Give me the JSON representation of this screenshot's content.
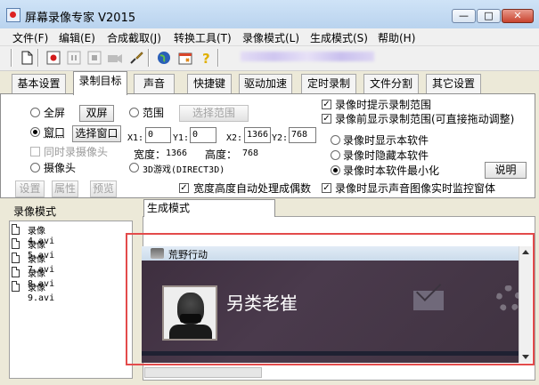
{
  "window": {
    "title": "屏幕录像专家 V2015",
    "min": "—",
    "max": "□",
    "close": "✕"
  },
  "menu": [
    "文件(F)",
    "编辑(E)",
    "合成截取(J)",
    "转换工具(T)",
    "录像模式(L)",
    "生成模式(S)",
    "帮助(H)"
  ],
  "toolbar_icons": [
    "new-file-icon",
    "record-icon",
    "pause-icon",
    "stop-icon",
    "camera-icon",
    "brush-icon",
    "globe-icon",
    "calendar-icon",
    "help-icon"
  ],
  "tabs": [
    "基本设置",
    "录制目标",
    "声音",
    "快捷键",
    "驱动加速",
    "定时录制",
    "文件分割",
    "其它设置"
  ],
  "active_tab": "录制目标",
  "target": {
    "fullscreen": "全屏",
    "dual_screen": "双屏",
    "range": "范围",
    "select_range": "选择范围",
    "window": "窗口",
    "select_window": "选择窗口",
    "x1_label": "X1:",
    "x1": "0",
    "y1_label": "Y1:",
    "y1": "0",
    "x2_label": "X2:",
    "x2": "1366",
    "y2_label": "Y2:",
    "y2": "768",
    "also_camera": "同时录摄像头",
    "width_label": "宽度：",
    "width": "1366",
    "height_label": "高度：",
    "height": "768",
    "camera": "摄像头",
    "game3d": "3D游戏(DIRECT3D)",
    "settings": "设置",
    "props": "属性",
    "preview": "预览",
    "auto_even": "宽度高度自动处理成偶数"
  },
  "options": {
    "prompt_range": "录像时提示录制范围",
    "show_range": "录像前显示录制范围(可直接拖动调整)",
    "show_soft": "录像时显示本软件",
    "hide_soft": "录像时隐藏本软件",
    "minimize_soft": "录像时本软件最小化",
    "explain": "说明",
    "show_monitor": "录像时显示声音图像实时监控窗体"
  },
  "section": {
    "record_mode": "录像模式",
    "gen_mode": "生成模式"
  },
  "files": [
    "录像4.avi",
    "录像5.avi",
    "录像7.avi",
    "录像8.avi",
    "录像9.avi"
  ],
  "preview_window": {
    "title": "荒野行动",
    "player": "另类老崔"
  }
}
